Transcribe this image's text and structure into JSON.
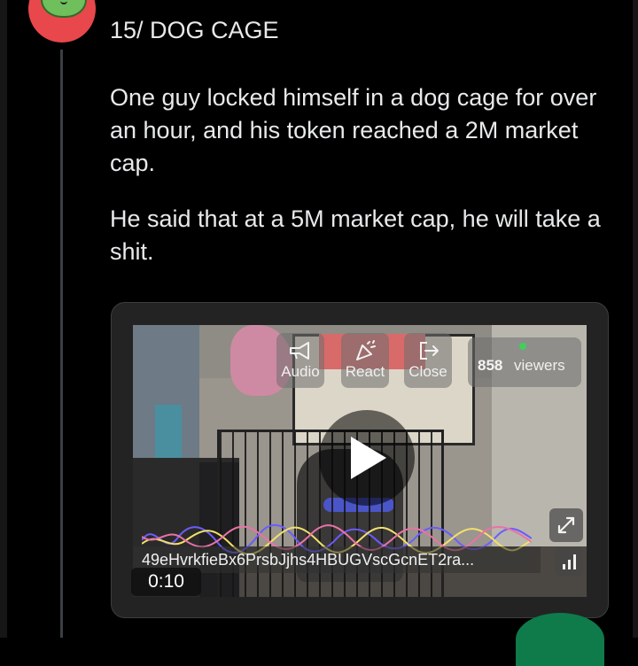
{
  "post": {
    "title": "15/ DOG CAGE",
    "paragraph_1": "One guy locked himself in a dog cage for over an hour, and his token reached a 2M market cap.",
    "paragraph_2": "He said that at a 5M market cap, he will take a shit."
  },
  "video": {
    "controls": {
      "audio_label": "Audio",
      "react_label": "React",
      "close_label": "Close"
    },
    "viewers": {
      "count": "858",
      "label": "viewers"
    },
    "token_id": "49eHvrkfieBx6PrsbJjhs4HBUGVscGcnET2ra...",
    "duration": "0:10",
    "icons": {
      "audio": "megaphone-icon",
      "react": "party-popper-icon",
      "close": "exit-icon",
      "play": "play-icon",
      "expand": "expand-icon",
      "signal": "signal-bars-icon"
    }
  },
  "colors": {
    "background": "#000000",
    "text": "#e7e9ea",
    "live_dot": "#3ecf5c",
    "avatar_bg": "#e8474b"
  }
}
